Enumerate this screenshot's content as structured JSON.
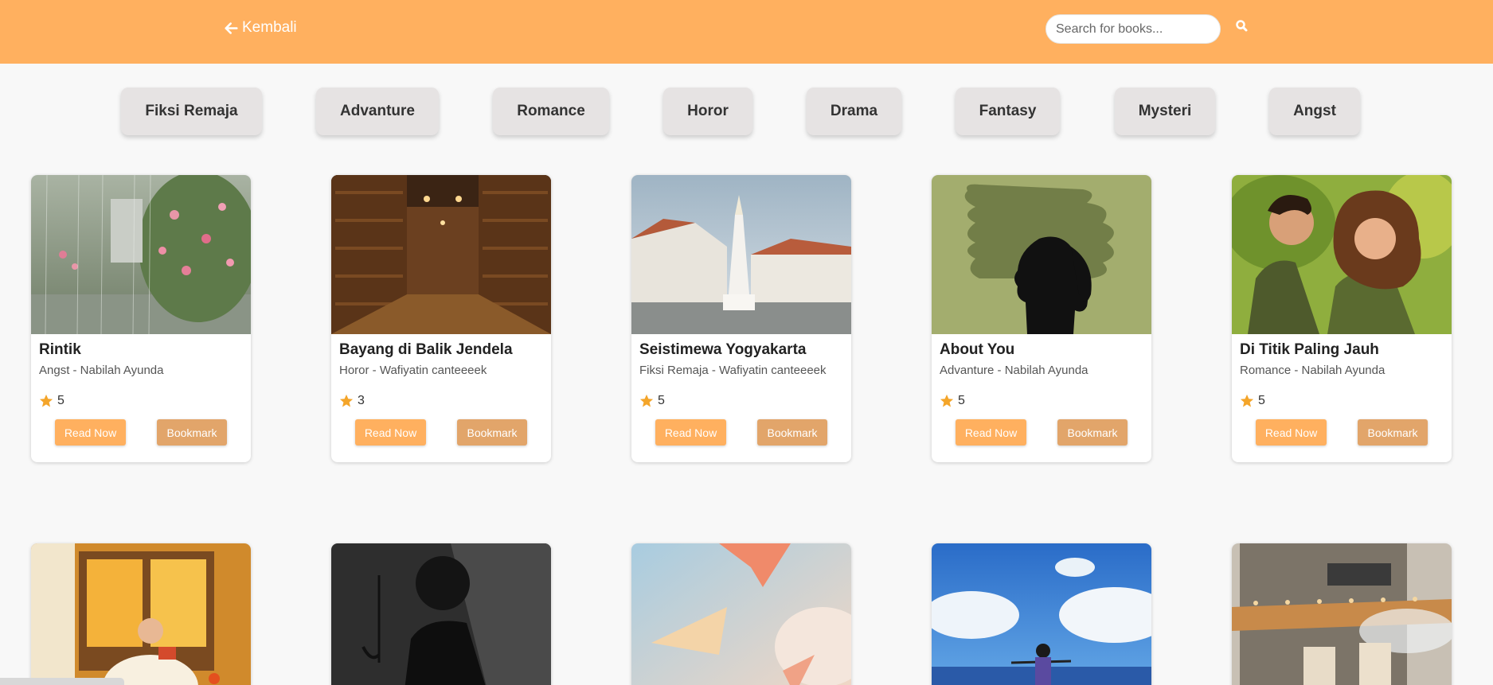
{
  "header": {
    "back_label": "Kembali",
    "search_placeholder": "Search for books..."
  },
  "genres": [
    "Fiksi Remaja",
    "Advanture",
    "Romance",
    "Horor",
    "Drama",
    "Fantasy",
    "Mysteri",
    "Angst"
  ],
  "books": [
    {
      "title": "Rintik",
      "meta": "Angst - Nabilah Ayunda",
      "rating": "5",
      "read_label": "Read Now",
      "bookmark_label": "Bookmark"
    },
    {
      "title": "Bayang di Balik Jendela",
      "meta": "Horor - Wafiyatin canteeeek",
      "rating": "3",
      "read_label": "Read Now",
      "bookmark_label": "Bookmark"
    },
    {
      "title": "Seistimewa Yogyakarta",
      "meta": "Fiksi Remaja - Wafiyatin canteeeek",
      "rating": "5",
      "read_label": "Read Now",
      "bookmark_label": "Bookmark"
    },
    {
      "title": "About You",
      "meta": "Advanture - Nabilah Ayunda",
      "rating": "5",
      "read_label": "Read Now",
      "bookmark_label": "Bookmark"
    },
    {
      "title": "Di Titik Paling Jauh",
      "meta": "Romance - Nabilah Ayunda",
      "rating": "5",
      "read_label": "Read Now",
      "bookmark_label": "Bookmark"
    }
  ],
  "colors": {
    "header": "#ffb05f",
    "read_button": "#ffb05f",
    "bookmark_button": "#e2a56a",
    "star": "#f4a52a"
  }
}
